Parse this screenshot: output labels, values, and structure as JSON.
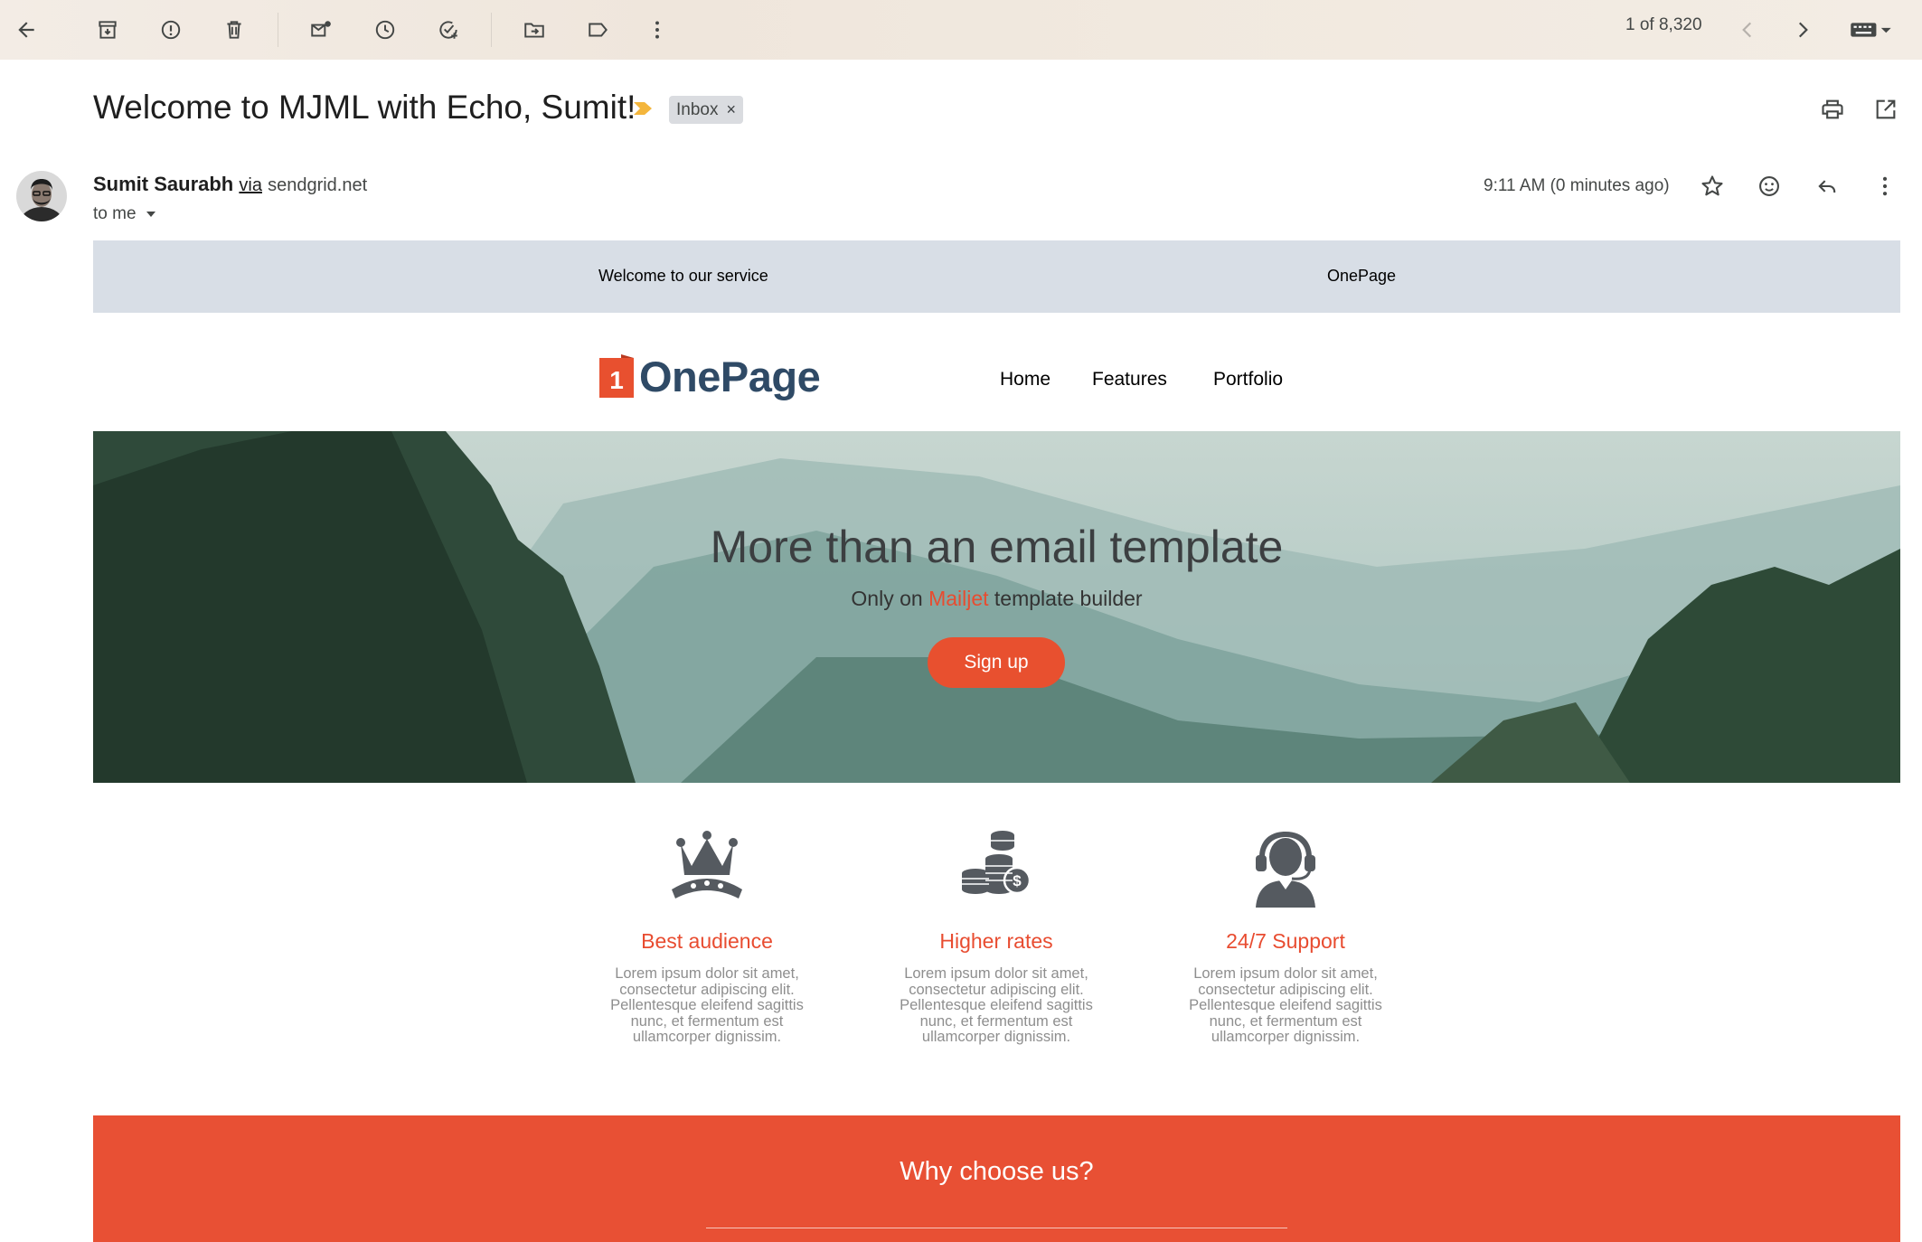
{
  "toolbar": {
    "icons": [
      "back-arrow-icon",
      "archive-icon",
      "report-spam-icon",
      "delete-icon",
      "mark-unread-icon",
      "snooze-icon",
      "add-to-tasks-icon",
      "move-to-icon",
      "labels-icon",
      "more-vert-icon",
      "newer-icon",
      "older-icon",
      "input-tools-icon"
    ],
    "count": "1 of 8,320"
  },
  "message": {
    "subject": "Welcome to MJML with Echo, Sumit!",
    "label": "Inbox",
    "label_remove": "×",
    "sender_name": "Sumit Saurabh",
    "via": "via",
    "sender_domain": "sendgrid.net",
    "to": "to me",
    "time": "9:11 AM (0 minutes ago)"
  },
  "email": {
    "preheader_left": "Welcome to our service",
    "preheader_right": "OnePage",
    "logo_badge": "1",
    "logo_text": "OnePage",
    "nav": [
      "Home",
      "Features",
      "Portfolio"
    ],
    "hero_title": "More than an email template",
    "hero_sub_prefix": "Only on",
    "hero_sub_accent": "Mailjet",
    "hero_sub_suffix": "template builder",
    "cta": "Sign up",
    "features": [
      {
        "icon": "crown-icon",
        "title": "Best audience",
        "text": "Lorem ipsum dolor sit amet, consectetur adipiscing elit. Pellentesque eleifend sagittis nunc, et fermentum est ullamcorper dignissim."
      },
      {
        "icon": "coins-icon",
        "title": "Higher rates",
        "text": "Lorem ipsum dolor sit amet, consectetur adipiscing elit. Pellentesque eleifend sagittis nunc, et fermentum est ullamcorper dignissim."
      },
      {
        "icon": "headset-support-icon",
        "title": "24/7 Support",
        "text": "Lorem ipsum dolor sit amet, consectetur adipiscing elit. Pellentesque eleifend sagittis nunc, et fermentum est ullamcorper dignissim."
      }
    ],
    "why_title": "Why choose us?"
  },
  "colors": {
    "accent": "#e8502f",
    "preheader_bg": "#d8dee6",
    "logo_blue": "#2f4a66",
    "feature_text": "#8e8e8e"
  }
}
